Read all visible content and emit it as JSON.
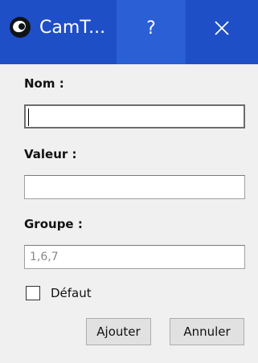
{
  "window": {
    "title": "CamT...",
    "help_label": "?",
    "icons": {
      "app": "camera-eye-icon",
      "close": "close-icon"
    },
    "colors": {
      "titlebar": "#1f4fc6",
      "help_highlight": "#2a5fd6",
      "background": "#f0f0f0"
    }
  },
  "form": {
    "name_label": "Nom :",
    "name_value": "",
    "value_label": "Valeur :",
    "value_value": "",
    "group_label": "Groupe :",
    "group_value": "",
    "group_placeholder": "1,6,7",
    "default_label": "Défaut",
    "default_checked": false
  },
  "buttons": {
    "add_label": "Ajouter",
    "cancel_label": "Annuler"
  }
}
